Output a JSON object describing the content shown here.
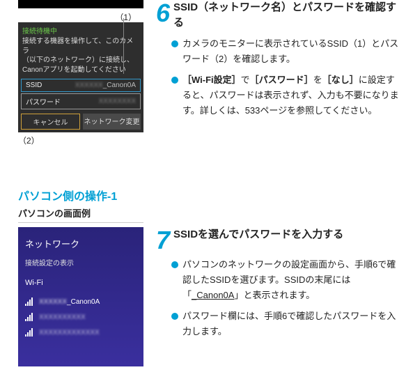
{
  "monitor": {
    "callout1": "（1）",
    "callout2": "（2）",
    "status": "接続待機中",
    "msg1": "接続する機器を操作して、このカメラ",
    "msg2": "（以下のネットワーク）に接続し、",
    "msg3": "Canonアプリを起動してください",
    "ssid_label": "SSID",
    "ssid_value": "_Canon0A",
    "pw_label": "パスワード",
    "btn_cancel": "キャンセル",
    "btn_netchg": "ネットワーク変更"
  },
  "step6": {
    "num": "6",
    "title": "SSID（ネットワーク名）とパスワードを確認する",
    "b1": "カメラのモニターに表示されているSSID（1）とパスワード（2）を確認します。",
    "b2a": "［Wi-Fi設定］",
    "b2b": "で",
    "b2c": "［パスワード］",
    "b2d": "を",
    "b2e": "［なし］",
    "b2f": "に設定すると、パスワードは表示されず、入力も不要になります。詳しくは、533ページを参照してください。"
  },
  "section": {
    "title": "パソコン側の操作-1",
    "sub": "パソコンの画面例"
  },
  "pc": {
    "hdr": "ネットワーク",
    "link": "接続設定の表示",
    "wifi": "Wi-Fi",
    "net1_suffix": "_Canon0A"
  },
  "step7": {
    "num": "7",
    "title": "SSIDを選んでパスワードを入力する",
    "b1a": "パソコンのネットワークの設定画面から、手順6で確認したSSIDを選びます。SSIDの末尾には「",
    "b1b": "_Canon0A",
    "b1c": "」と表示されます。",
    "b2": "パスワード欄には、手順6で確認したパスワードを入力します。"
  }
}
